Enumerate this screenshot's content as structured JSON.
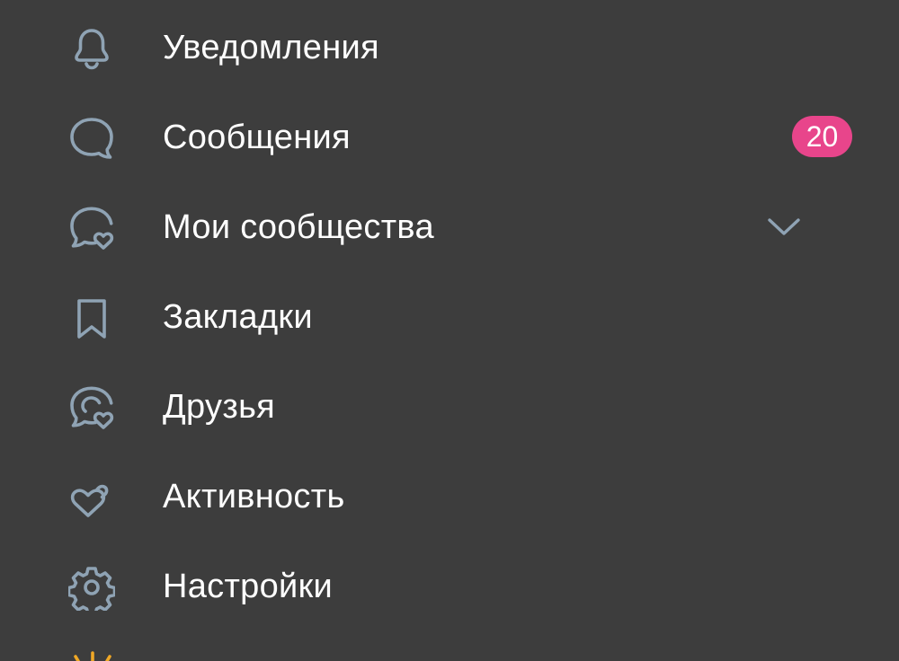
{
  "colors": {
    "background": "#3d3d3d",
    "icon": "#8fa3b4",
    "text": "#ffffff",
    "badge": "#e8458b",
    "partial_icon": "#f0a826"
  },
  "menu": {
    "items": [
      {
        "label": "Уведомления",
        "icon": "bell-icon"
      },
      {
        "label": "Сообщения",
        "icon": "message-bubble-icon",
        "badge": "20"
      },
      {
        "label": "Мои сообщества",
        "icon": "communities-heart-icon",
        "chevron": "chevron-down-icon"
      },
      {
        "label": "Закладки",
        "icon": "bookmark-icon"
      },
      {
        "label": "Друзья",
        "icon": "friends-heart-icon"
      },
      {
        "label": "Активность",
        "icon": "hearts-icon"
      },
      {
        "label": "Настройки",
        "icon": "gear-icon"
      }
    ],
    "partial_item_icon": "sun-icon"
  }
}
